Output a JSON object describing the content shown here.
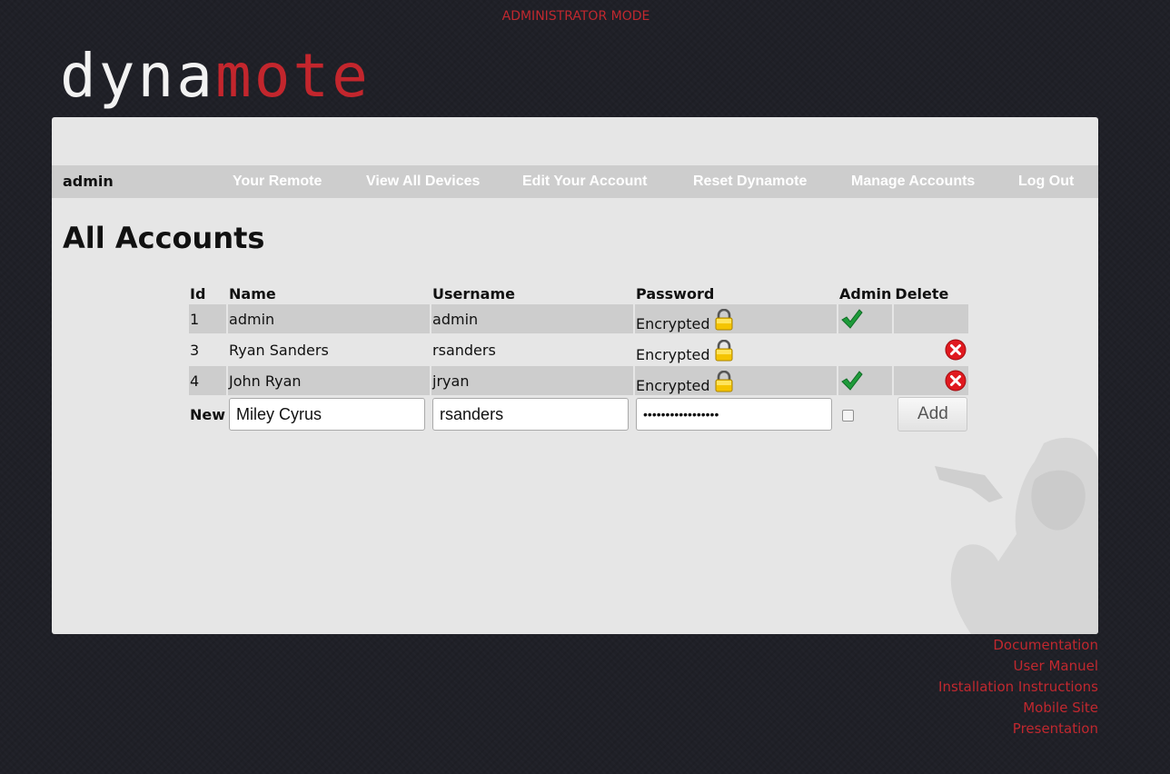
{
  "banner": "ADMINISTRATOR MODE",
  "logo": {
    "part1": "dyna",
    "part2": "mote"
  },
  "nav": {
    "user": "admin",
    "links": [
      "Your Remote",
      "View All Devices",
      "Edit Your Account",
      "Reset Dynamote",
      "Manage Accounts",
      "Log Out"
    ]
  },
  "page": {
    "title": "All Accounts"
  },
  "table": {
    "headers": [
      "Id",
      "Name",
      "Username",
      "Password",
      "Admin",
      "Delete"
    ],
    "rows": [
      {
        "id": "1",
        "name": "admin",
        "username": "admin",
        "password": "Encrypted",
        "admin": true,
        "deletable": false
      },
      {
        "id": "3",
        "name": "Ryan Sanders",
        "username": "rsanders",
        "password": "Encrypted",
        "admin": false,
        "deletable": true
      },
      {
        "id": "4",
        "name": "John Ryan",
        "username": "jryan",
        "password": "Encrypted",
        "admin": true,
        "deletable": true
      }
    ],
    "new_row": {
      "label": "New",
      "name_value": "Miley Cyrus",
      "username_value": "rsanders",
      "password_value": "•••••••••••••••••",
      "admin_checked": false,
      "add_label": "Add"
    }
  },
  "footer": {
    "links": [
      "Documentation",
      "User Manuel",
      "Installation Instructions",
      "Mobile Site",
      "Presentation"
    ]
  },
  "colors": {
    "accent": "#c3262d",
    "panel": "#e6e6e6",
    "nav": "#cdcdcd",
    "background": "#1f2027"
  }
}
